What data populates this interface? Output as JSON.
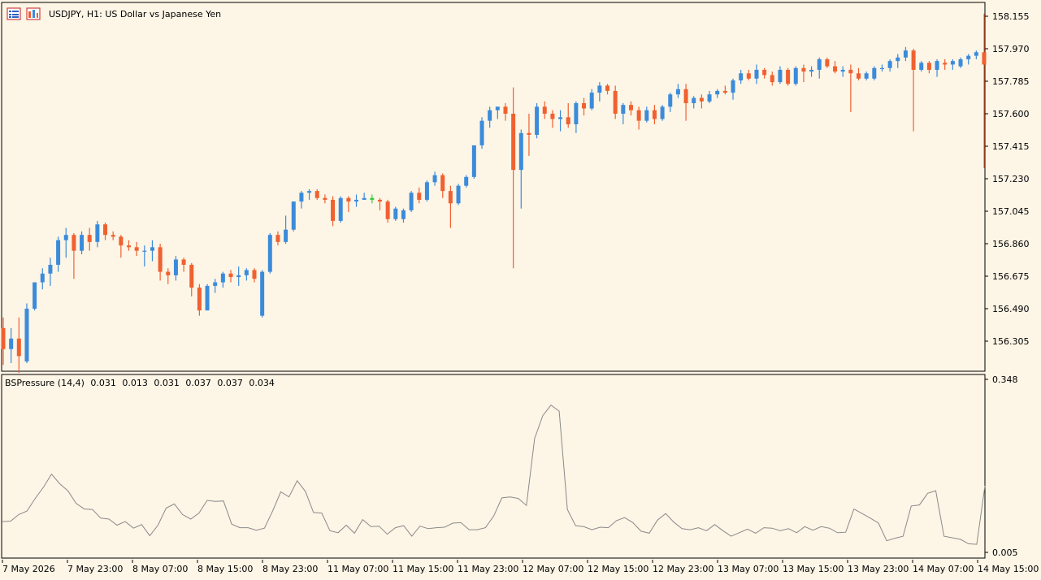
{
  "chart_header": {
    "title": "USDJPY, H1:  US Dollar vs Japanese Yen",
    "icons": [
      "chart-list-icon",
      "chart-properties-icon"
    ]
  },
  "indicator_header": {
    "name": "BSPressure (14,4)",
    "values": [
      "0.031",
      "0.013",
      "0.031",
      "0.037",
      "0.037",
      "0.034"
    ]
  },
  "colors": {
    "background": "#fdf5e6",
    "bull": "#3b8bdb",
    "bear": "#f06030",
    "doji": "#2ecc40",
    "indicator_line": "#8a8a8a",
    "grid": "#000000"
  },
  "chart_data": [
    {
      "type": "candlestick",
      "symbol": "USDJPY",
      "timeframe": "H1",
      "yticks": [
        "158.155",
        "157.970",
        "157.785",
        "157.600",
        "157.415",
        "157.230",
        "157.045",
        "156.860",
        "156.675",
        "156.490",
        "156.305"
      ],
      "ylim": [
        156.22,
        158.18
      ],
      "candles": [
        [
          156.38,
          156.44,
          156.17,
          156.26
        ],
        [
          156.26,
          156.38,
          156.18,
          156.32
        ],
        [
          156.32,
          156.44,
          156.1,
          156.22
        ],
        [
          156.19,
          156.52,
          156.18,
          156.49
        ],
        [
          156.49,
          156.63,
          156.48,
          156.64
        ],
        [
          156.64,
          156.72,
          156.6,
          156.69
        ],
        [
          156.69,
          156.78,
          156.62,
          156.74
        ],
        [
          156.74,
          156.9,
          156.7,
          156.88
        ],
        [
          156.88,
          156.95,
          156.78,
          156.91
        ],
        [
          156.91,
          156.92,
          156.66,
          156.82
        ],
        [
          156.82,
          156.93,
          156.8,
          156.91
        ],
        [
          156.91,
          156.95,
          156.82,
          156.87
        ],
        [
          156.87,
          156.99,
          156.84,
          156.97
        ],
        [
          156.97,
          156.98,
          156.88,
          156.91
        ],
        [
          156.91,
          156.93,
          156.88,
          156.9
        ],
        [
          156.9,
          156.91,
          156.78,
          156.85
        ],
        [
          156.85,
          156.88,
          156.82,
          156.84
        ],
        [
          156.84,
          156.87,
          156.79,
          156.82
        ],
        [
          156.82,
          156.85,
          156.73,
          156.82
        ],
        [
          156.82,
          156.88,
          156.76,
          156.84
        ],
        [
          156.84,
          156.86,
          156.65,
          156.7
        ],
        [
          156.7,
          156.72,
          156.63,
          156.68
        ],
        [
          156.68,
          156.79,
          156.65,
          156.77
        ],
        [
          156.77,
          156.78,
          156.7,
          156.74
        ],
        [
          156.74,
          156.75,
          156.56,
          156.61
        ],
        [
          156.61,
          156.63,
          156.45,
          156.48
        ],
        [
          156.48,
          156.63,
          156.48,
          156.62
        ],
        [
          156.62,
          156.66,
          156.58,
          156.64
        ],
        [
          156.64,
          156.7,
          156.61,
          156.69
        ],
        [
          156.69,
          156.71,
          156.64,
          156.67
        ],
        [
          156.67,
          156.73,
          156.62,
          156.68
        ],
        [
          156.68,
          156.72,
          156.65,
          156.71
        ],
        [
          156.71,
          156.72,
          156.64,
          156.66
        ],
        [
          156.45,
          156.71,
          156.44,
          156.7
        ],
        [
          156.7,
          156.92,
          156.69,
          156.91
        ],
        [
          156.91,
          156.93,
          156.85,
          156.87
        ],
        [
          156.87,
          157.02,
          156.86,
          156.94
        ],
        [
          156.94,
          157.1,
          156.93,
          157.1
        ],
        [
          157.1,
          157.16,
          157.06,
          157.15
        ],
        [
          157.15,
          157.17,
          157.11,
          157.16
        ],
        [
          157.16,
          157.17,
          157.11,
          157.12
        ],
        [
          157.12,
          157.14,
          157.09,
          157.11
        ],
        [
          157.11,
          157.13,
          156.96,
          156.99
        ],
        [
          156.99,
          157.13,
          156.98,
          157.12
        ],
        [
          157.12,
          157.13,
          157.04,
          157.1
        ],
        [
          157.1,
          157.14,
          157.07,
          157.11
        ],
        [
          157.11,
          157.15,
          157.11,
          157.12
        ],
        [
          157.12,
          157.14,
          157.09,
          157.11
        ],
        [
          157.11,
          157.12,
          157.05,
          157.1
        ],
        [
          157.1,
          157.11,
          156.98,
          157.0
        ],
        [
          157.0,
          157.07,
          156.99,
          157.06
        ],
        [
          157.0,
          157.06,
          156.98,
          157.05
        ],
        [
          157.05,
          157.16,
          157.04,
          157.15
        ],
        [
          157.15,
          157.18,
          157.09,
          157.11
        ],
        [
          157.11,
          157.22,
          157.1,
          157.21
        ],
        [
          157.21,
          157.27,
          157.19,
          157.25
        ],
        [
          157.25,
          157.26,
          157.12,
          157.16
        ],
        [
          157.16,
          157.19,
          156.95,
          157.09
        ],
        [
          157.09,
          157.2,
          157.08,
          157.19
        ],
        [
          157.19,
          157.25,
          157.18,
          157.24
        ],
        [
          157.24,
          157.42,
          157.23,
          157.42
        ],
        [
          157.42,
          157.58,
          157.4,
          157.56
        ],
        [
          157.56,
          157.64,
          157.52,
          157.62
        ],
        [
          157.62,
          157.64,
          157.57,
          157.64
        ],
        [
          157.64,
          157.66,
          157.56,
          157.6
        ],
        [
          157.6,
          157.75,
          156.72,
          157.28
        ],
        [
          157.28,
          157.51,
          157.06,
          157.49
        ],
        [
          157.49,
          157.6,
          157.36,
          157.48
        ],
        [
          157.48,
          157.66,
          157.46,
          157.64
        ],
        [
          157.64,
          157.67,
          157.57,
          157.6
        ],
        [
          157.6,
          157.62,
          157.52,
          157.57
        ],
        [
          157.57,
          157.62,
          157.5,
          157.58
        ],
        [
          157.58,
          157.66,
          157.52,
          157.54
        ],
        [
          157.54,
          157.67,
          157.49,
          157.66
        ],
        [
          157.66,
          157.69,
          157.59,
          157.63
        ],
        [
          157.63,
          157.74,
          157.62,
          157.72
        ],
        [
          157.72,
          157.78,
          157.67,
          157.76
        ],
        [
          157.76,
          157.77,
          157.71,
          157.73
        ],
        [
          157.73,
          157.76,
          157.57,
          157.6
        ],
        [
          157.6,
          157.66,
          157.54,
          157.65
        ],
        [
          157.65,
          157.67,
          157.59,
          157.62
        ],
        [
          157.62,
          157.64,
          157.51,
          157.56
        ],
        [
          157.56,
          157.64,
          157.55,
          157.62
        ],
        [
          157.62,
          157.65,
          157.54,
          157.57
        ],
        [
          157.57,
          157.65,
          157.56,
          157.64
        ],
        [
          157.64,
          157.72,
          157.61,
          157.71
        ],
        [
          157.71,
          157.77,
          157.69,
          157.74
        ],
        [
          157.74,
          157.77,
          157.56,
          157.66
        ],
        [
          157.66,
          157.7,
          157.63,
          157.69
        ],
        [
          157.69,
          157.71,
          157.63,
          157.67
        ],
        [
          157.67,
          157.73,
          157.66,
          157.71
        ],
        [
          157.71,
          157.74,
          157.69,
          157.73
        ],
        [
          157.73,
          157.76,
          157.71,
          157.72
        ],
        [
          157.72,
          157.8,
          157.68,
          157.79
        ],
        [
          157.79,
          157.85,
          157.77,
          157.83
        ],
        [
          157.83,
          157.85,
          157.79,
          157.8
        ],
        [
          157.8,
          157.88,
          157.77,
          157.85
        ],
        [
          157.85,
          157.86,
          157.8,
          157.82
        ],
        [
          157.82,
          157.84,
          157.76,
          157.78
        ],
        [
          157.78,
          157.87,
          157.77,
          157.85
        ],
        [
          157.85,
          157.86,
          157.76,
          157.77
        ],
        [
          157.77,
          157.87,
          157.76,
          157.86
        ],
        [
          157.86,
          157.88,
          157.78,
          157.84
        ],
        [
          157.84,
          157.87,
          157.81,
          157.85
        ],
        [
          157.85,
          157.92,
          157.8,
          157.91
        ],
        [
          157.91,
          157.92,
          157.86,
          157.87
        ],
        [
          157.87,
          157.9,
          157.83,
          157.84
        ],
        [
          157.84,
          157.87,
          157.81,
          157.85
        ],
        [
          157.85,
          157.88,
          157.61,
          157.83
        ],
        [
          157.83,
          157.86,
          157.79,
          157.8
        ],
        [
          157.8,
          157.84,
          157.79,
          157.83
        ],
        [
          157.8,
          157.87,
          157.79,
          157.86
        ],
        [
          157.86,
          157.88,
          157.84,
          157.86
        ],
        [
          157.86,
          157.91,
          157.84,
          157.9
        ],
        [
          157.9,
          157.94,
          157.86,
          157.92
        ],
        [
          157.92,
          157.98,
          157.9,
          157.96
        ],
        [
          157.96,
          157.97,
          157.5,
          157.85
        ],
        [
          157.85,
          157.9,
          157.84,
          157.89
        ],
        [
          157.89,
          157.9,
          157.83,
          157.85
        ],
        [
          157.85,
          157.91,
          157.81,
          157.9
        ],
        [
          157.89,
          157.91,
          157.85,
          157.88
        ],
        [
          157.88,
          157.91,
          157.85,
          157.9
        ],
        [
          157.87,
          157.92,
          157.86,
          157.91
        ],
        [
          157.91,
          157.94,
          157.88,
          157.93
        ],
        [
          157.93,
          157.96,
          157.91,
          157.95
        ],
        [
          157.95,
          158.17,
          157.29,
          157.88
        ]
      ],
      "doji_index": 47
    },
    {
      "type": "line",
      "name": "BSPressure (14,4)",
      "yticks": [
        "0.348",
        "0.005"
      ],
      "ylim": [
        0.005,
        0.348
      ],
      "values": [
        0.066,
        0.067,
        0.08,
        0.087,
        0.112,
        0.134,
        0.16,
        0.141,
        0.127,
        0.102,
        0.091,
        0.09,
        0.073,
        0.071,
        0.059,
        0.066,
        0.053,
        0.06,
        0.038,
        0.059,
        0.093,
        0.101,
        0.08,
        0.071,
        0.083,
        0.108,
        0.106,
        0.107,
        0.061,
        0.054,
        0.054,
        0.049,
        0.053,
        0.087,
        0.125,
        0.115,
        0.147,
        0.126,
        0.084,
        0.083,
        0.048,
        0.044,
        0.059,
        0.043,
        0.07,
        0.056,
        0.057,
        0.041,
        0.054,
        0.058,
        0.037,
        0.057,
        0.052,
        0.054,
        0.055,
        0.063,
        0.064,
        0.05,
        0.05,
        0.054,
        0.077,
        0.113,
        0.115,
        0.112,
        0.098,
        0.231,
        0.276,
        0.297,
        0.285,
        0.09,
        0.058,
        0.056,
        0.05,
        0.055,
        0.054,
        0.068,
        0.074,
        0.064,
        0.047,
        0.043,
        0.069,
        0.082,
        0.065,
        0.052,
        0.05,
        0.054,
        0.048,
        0.06,
        0.048,
        0.037,
        0.044,
        0.051,
        0.043,
        0.054,
        0.053,
        0.048,
        0.052,
        0.044,
        0.056,
        0.049,
        0.056,
        0.053,
        0.044,
        0.045,
        0.091,
        0.082,
        0.073,
        0.063,
        0.028,
        0.033,
        0.037,
        0.097,
        0.099,
        0.122,
        0.127,
        0.037,
        0.034,
        0.031,
        0.022,
        0.021,
        0.137
      ]
    }
  ],
  "time_axis": {
    "labels": [
      "7 May 2026",
      "7 May 23:00",
      "8 May 07:00",
      "8 May 15:00",
      "8 May 23:00",
      "11 May 07:00",
      "11 May 15:00",
      "11 May 23:00",
      "12 May 07:00",
      "12 May 15:00",
      "12 May 23:00",
      "13 May 07:00",
      "13 May 15:00",
      "13 May 23:00",
      "14 May 07:00",
      "14 May 15:00"
    ]
  }
}
